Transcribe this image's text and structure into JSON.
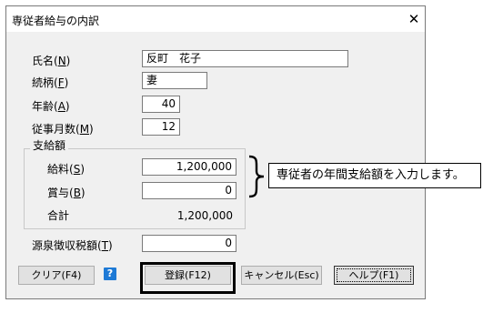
{
  "dialog": {
    "title": "専従者給与の内訳",
    "close_glyph": "✕"
  },
  "fields": {
    "name": {
      "label": "氏名(",
      "key": "N",
      "label_end": ")",
      "value": "反町　花子"
    },
    "relation": {
      "label": "続柄(",
      "key": "F",
      "label_end": ")",
      "value": "妻"
    },
    "age": {
      "label": "年齢(",
      "key": "A",
      "label_end": ")",
      "value": "40"
    },
    "months": {
      "label": "従事月数(",
      "key": "M",
      "label_end": ")",
      "value": "12"
    }
  },
  "payment": {
    "group_label": "支給額",
    "salary": {
      "label": "給料(",
      "key": "S",
      "label_end": ")",
      "value": "1,200,000"
    },
    "bonus": {
      "label": "賞与(",
      "key": "B",
      "label_end": ")",
      "value": "0"
    },
    "total": {
      "label": "合計",
      "value": "1,200,000"
    }
  },
  "withholding": {
    "label": "源泉徴収税額(",
    "key": "T",
    "label_end": ")",
    "value": "0"
  },
  "buttons": {
    "clear": "クリア(F4)",
    "help_icon_glyph": "?",
    "register": "登録(F12)",
    "cancel": "キャンセル(Esc)",
    "help": "ヘルプ(F1)"
  },
  "callout": {
    "text": "専従者の年間支給額を入力します。"
  },
  "colors": {
    "dialog_bg": "#f0f0f0",
    "help_icon_bg": "#1e7ad6",
    "highlight_border": "#000000"
  }
}
